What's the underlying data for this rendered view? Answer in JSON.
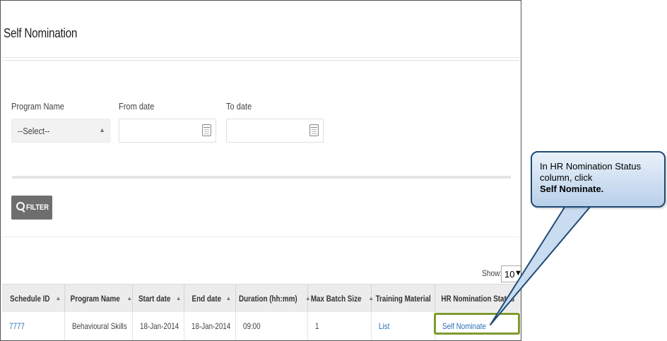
{
  "page": {
    "title": "Self Nomination"
  },
  "filters": {
    "program_name_label": "Program Name",
    "program_name_value": "--Select--",
    "from_date_label": "From date",
    "from_date_value": "",
    "to_date_label": "To date",
    "to_date_value": "",
    "filter_button": "FILTER"
  },
  "table": {
    "show_label": "Show:",
    "show_value": "10",
    "columns": [
      "Schedule ID",
      "Program Name",
      "Start date",
      "End date",
      "Duration (hh:mm)",
      "Max Batch Size",
      "Training Material",
      "HR Nomination Status"
    ],
    "rows": [
      {
        "schedule_id": "7777",
        "program_name": "Behavioural Skills",
        "start_date": "18-Jan-2014",
        "end_date": "18-Jan-2014",
        "duration": "09:00",
        "max_batch": "1",
        "material": "List",
        "status": "Self Nominate"
      }
    ]
  },
  "callout": {
    "text": "In HR Nomination Status column, click",
    "bold": "Self Nominate."
  },
  "colors": {
    "link": "#2a6fb5",
    "highlight": "#7e9a2e",
    "callout_border": "#1f4a75"
  }
}
